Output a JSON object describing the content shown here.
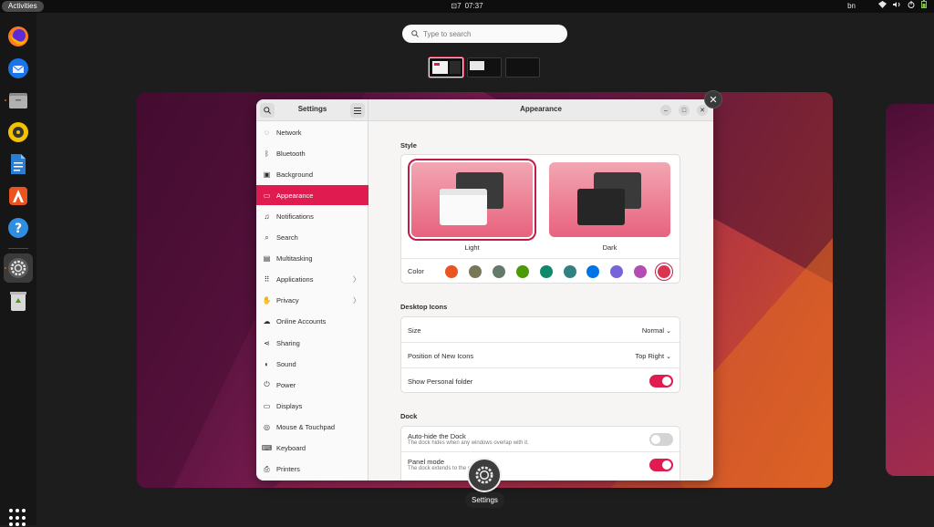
{
  "topbar": {
    "activities": "Activities",
    "workspace_indicator": "7",
    "time": "07:37",
    "language": "bn",
    "icons": [
      "network-icon",
      "volume-icon",
      "power-icon",
      "battery-icon"
    ]
  },
  "dock": {
    "apps": [
      {
        "name": "Firefox",
        "icon": "firefox-icon"
      },
      {
        "name": "Thunderbird",
        "icon": "thunderbird-icon"
      },
      {
        "name": "Files",
        "icon": "files-icon"
      },
      {
        "name": "Rhythmbox",
        "icon": "rhythmbox-icon"
      },
      {
        "name": "LibreOffice Writer",
        "icon": "writer-icon"
      },
      {
        "name": "Ubuntu Software",
        "icon": "software-icon"
      },
      {
        "name": "Help",
        "icon": "help-icon"
      },
      {
        "name": "Settings",
        "icon": "settings-icon"
      },
      {
        "name": "Trash",
        "icon": "trash-icon"
      }
    ],
    "app_grid": "show-apps-icon"
  },
  "overview": {
    "search_placeholder": "Type to search",
    "window_label": "Settings"
  },
  "settings": {
    "sidebar_title": "Settings",
    "main_title": "Appearance",
    "sidebar_items": [
      {
        "label": "Network",
        "icon": "network-icon"
      },
      {
        "label": "Bluetooth",
        "icon": "bluetooth-icon"
      },
      {
        "label": "Background",
        "icon": "background-icon"
      },
      {
        "label": "Appearance",
        "icon": "appearance-icon",
        "selected": true
      },
      {
        "label": "Notifications",
        "icon": "bell-icon"
      },
      {
        "label": "Search",
        "icon": "search-icon"
      },
      {
        "label": "Multitasking",
        "icon": "multitasking-icon"
      },
      {
        "label": "Applications",
        "icon": "applications-icon",
        "chevron": "〉"
      },
      {
        "label": "Privacy",
        "icon": "hand-icon",
        "chevron": "〉"
      },
      {
        "label": "Online Accounts",
        "icon": "cloud-icon"
      },
      {
        "label": "Sharing",
        "icon": "share-icon"
      },
      {
        "label": "Sound",
        "icon": "speaker-icon"
      },
      {
        "label": "Power",
        "icon": "power-icon"
      },
      {
        "label": "Displays",
        "icon": "display-icon"
      },
      {
        "label": "Mouse & Touchpad",
        "icon": "mouse-icon"
      },
      {
        "label": "Keyboard",
        "icon": "keyboard-icon"
      },
      {
        "label": "Printers",
        "icon": "printer-icon"
      }
    ],
    "style": {
      "heading": "Style",
      "light_label": "Light",
      "dark_label": "Dark",
      "selected": "Light",
      "color_label": "Color",
      "colors": [
        "#e95420",
        "#787859",
        "#657b69",
        "#4e9a06",
        "#0e8a6b",
        "#308280",
        "#0073e5",
        "#7764d8",
        "#b34cb3",
        "#da3450"
      ],
      "selected_color": "#da3450"
    },
    "desktop_icons": {
      "heading": "Desktop Icons",
      "size_label": "Size",
      "size_value": "Normal",
      "position_label": "Position of New Icons",
      "position_value": "Top Right",
      "personal_folder_label": "Show Personal folder",
      "personal_folder_on": true
    },
    "dock": {
      "heading": "Dock",
      "autohide_label": "Auto-hide the Dock",
      "autohide_sub": "The dock hides when any windows overlap with it.",
      "autohide_on": false,
      "panel_label": "Panel mode",
      "panel_sub": "The dock extends to the screen edge.",
      "panel_on": true
    }
  }
}
